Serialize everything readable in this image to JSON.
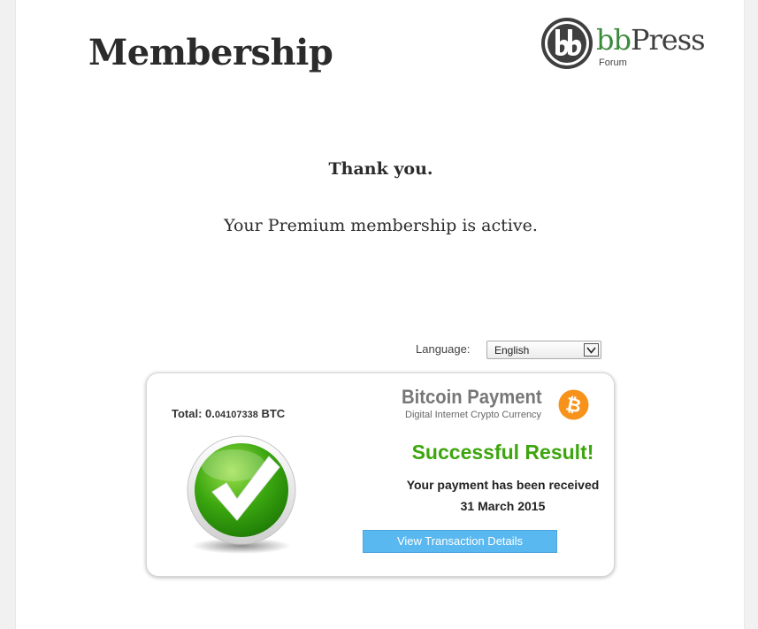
{
  "page": {
    "title": "Membership",
    "thank_you": "Thank you.",
    "membership_status": "Your Premium membership is active."
  },
  "logo": {
    "word_bb": "bb",
    "word_press": "Press",
    "subtitle": "Forum"
  },
  "language": {
    "label": "Language:",
    "selected": "English"
  },
  "payment_card": {
    "total_label": "Total: 0.",
    "total_amount": "04107338",
    "currency": "BTC",
    "brand_title": "Bitcoin Payment",
    "brand_subtitle": "Digital Internet Crypto Currency",
    "result_title": "Successful Result!",
    "result_message": "Your payment has been received",
    "result_date": "31 March 2015",
    "details_button": "View Transaction Details"
  },
  "colors": {
    "success_green": "#3da50d",
    "button_blue": "#5ab8f0",
    "bitcoin_orange": "#f7931a",
    "bbpress_green": "#3c8a3c"
  },
  "icons": {
    "logo": "bbpress-logo-icon",
    "dropdown": "chevron-down-icon",
    "bitcoin": "bitcoin-icon",
    "success": "checkmark-icon"
  }
}
